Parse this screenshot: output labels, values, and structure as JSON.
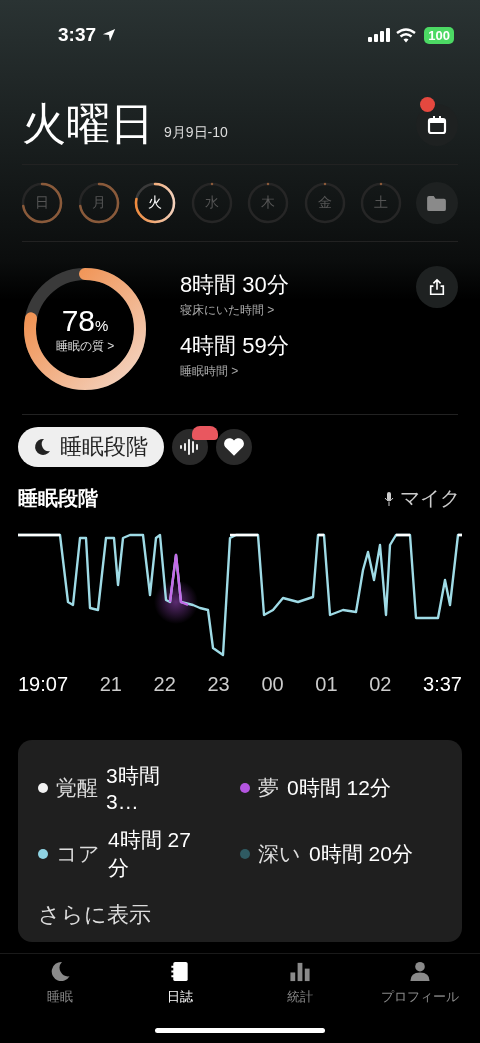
{
  "status_bar": {
    "time": "3:37",
    "battery": "100"
  },
  "header": {
    "title": "火曜日",
    "date_range": "9月9日-10",
    "calendar_badge": true
  },
  "days": [
    {
      "label": "日",
      "recorded": true,
      "selected": false
    },
    {
      "label": "月",
      "recorded": true,
      "selected": false
    },
    {
      "label": "火",
      "recorded": true,
      "selected": true
    },
    {
      "label": "水",
      "recorded": false,
      "selected": false
    },
    {
      "label": "木",
      "recorded": false,
      "selected": false
    },
    {
      "label": "金",
      "recorded": false,
      "selected": false
    },
    {
      "label": "土",
      "recorded": false,
      "selected": false
    }
  ],
  "summary": {
    "score": "78",
    "score_unit": "%",
    "score_label": "睡眠の質 >",
    "stats": [
      {
        "value": "8時間 30分",
        "label": "寝床にいた時間 >"
      },
      {
        "value": "4時間 59分",
        "label": "睡眠時間 >"
      }
    ]
  },
  "filters": [
    {
      "kind": "stages",
      "label": "睡眠段階",
      "selected": true
    },
    {
      "kind": "sound",
      "selected": false
    },
    {
      "kind": "heart",
      "selected": false
    }
  ],
  "chart": {
    "title": "睡眠段階",
    "source": "マイク",
    "xticks": [
      "19:07",
      "21",
      "22",
      "23",
      "00",
      "01",
      "02",
      "3:37"
    ]
  },
  "legend": [
    {
      "label": "覚醒",
      "value": "3時間 3…",
      "color": "#f2f2f2"
    },
    {
      "label": "夢",
      "value": "0時間 12分",
      "color": "#b455e0"
    },
    {
      "label": "コア",
      "value": "4時間 27 分",
      "color": "#8fd3e3"
    },
    {
      "label": "深い",
      "value": "0時間 20分",
      "color": "#2f5a62"
    }
  ],
  "more": "さらに表示",
  "tabs": [
    {
      "kind": "moon",
      "label": "睡眠",
      "selected": false
    },
    {
      "kind": "journal",
      "label": "日誌",
      "selected": true
    },
    {
      "kind": "stats",
      "label": "統計",
      "selected": false
    },
    {
      "kind": "profile",
      "label": "プロフィール",
      "selected": false
    }
  ]
}
